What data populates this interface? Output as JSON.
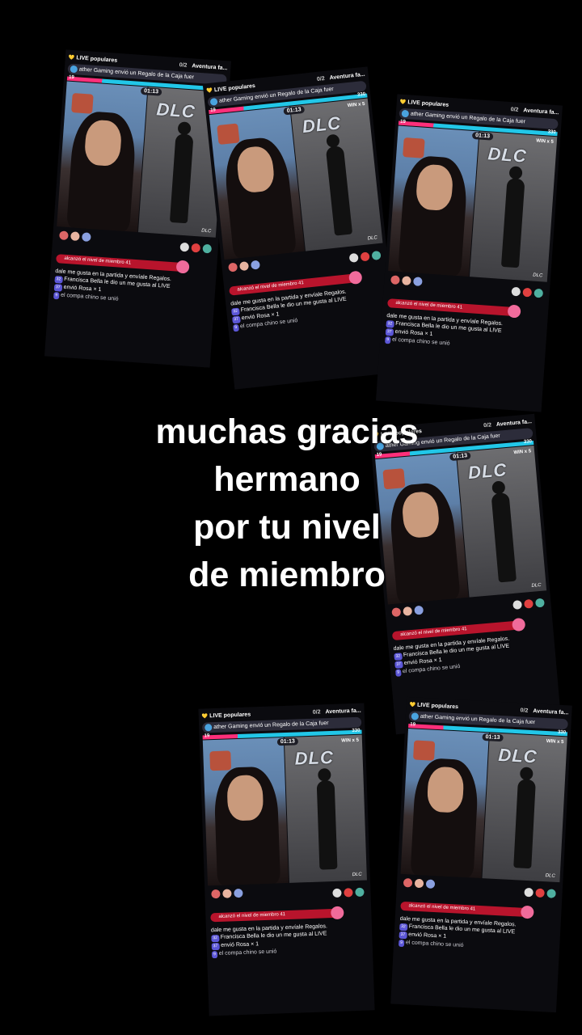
{
  "caption": {
    "line1": "muchas gracias",
    "line2": "hermano",
    "line3": "por tu nivel",
    "line4": "de miembro"
  },
  "stream": {
    "popular_label": "LIVE populares",
    "counter": "0/2",
    "adventure_label": "Aventura fa...",
    "gift_banner": "ather Gaming envió un Regalo de la Caja fuer",
    "left_level": "19",
    "right_score": "330",
    "timer": "01:13",
    "win_label": "WIN x 5",
    "logo_text": "DLC",
    "signature": "DLC",
    "member_level_msg": "alcanzó el nivel de miembro 41",
    "chat1": "dale me gusta en la partida y envíale Regalos.",
    "chat2": "Francisca Bella",
    "chat2b": "le dio un me gusta al LIVE",
    "chat3": "envió Rosa",
    "chat3b": "× 1",
    "chat4": "el compa chino se unió",
    "badge1": "32",
    "badge2": "37",
    "badge3": "9"
  },
  "colors": {
    "background": "#000000",
    "caption": "#ffffff",
    "left_team": "#ff2f7a",
    "right_team": "#22c7e8",
    "level_bar": "#b8142c"
  }
}
